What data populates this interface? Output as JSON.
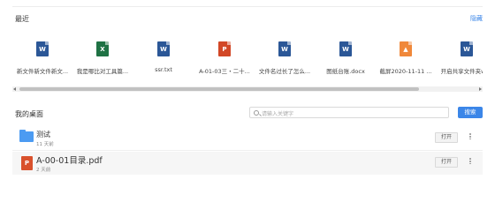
{
  "recent": {
    "title": "最近",
    "more_label": "隐藏",
    "files": [
      {
        "name": "新文件新文件新文...",
        "type": "word",
        "glyph": "W",
        "color": "#2b5797"
      },
      {
        "name": "我是哪比对工具篇...",
        "type": "excel",
        "glyph": "X",
        "color": "#1f7244"
      },
      {
        "name": "ssr.txt",
        "type": "word",
        "glyph": "W",
        "color": "#2b5797"
      },
      {
        "name": "A-01-03三・二十...",
        "type": "powerpoint",
        "glyph": "P",
        "color": "#d24726"
      },
      {
        "name": "文件名过长了怎么...",
        "type": "word",
        "glyph": "W",
        "color": "#2b5797"
      },
      {
        "name": "图纸台账.docx",
        "type": "word",
        "glyph": "W",
        "color": "#2b5797"
      },
      {
        "name": "截屏2020-11-11 ...",
        "type": "image",
        "glyph": "▲",
        "color": "#f0883a"
      },
      {
        "name": "开启共享文件夹wi...",
        "type": "word",
        "glyph": "W",
        "color": "#2b5797"
      }
    ]
  },
  "desktop": {
    "title": "我的桌面",
    "search_placeholder": "请输入关键字",
    "search_button": "搜索",
    "items": [
      {
        "name": "测试",
        "meta": "11 天前",
        "kind": "folder",
        "open_label": "打开"
      },
      {
        "name": "A-00-01目录.pdf",
        "meta": "2 天前",
        "kind": "pdf",
        "open_label": "打开"
      }
    ]
  },
  "colors": {
    "accent": "#3b86e8",
    "folder": "#4c9bf2",
    "pdf": "#d9512c"
  }
}
